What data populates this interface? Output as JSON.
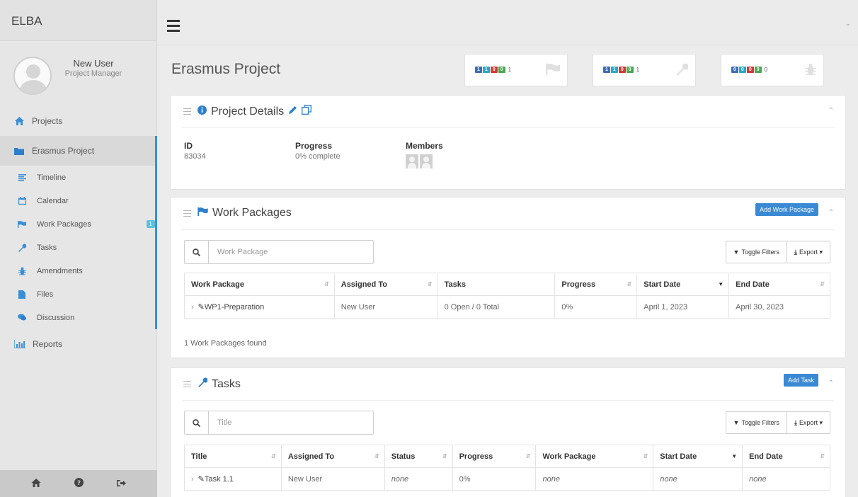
{
  "app": {
    "brand": "ELBA"
  },
  "user": {
    "name": "New User",
    "role": "Project Manager"
  },
  "sidebar": {
    "projects": "Projects",
    "project": "Erasmus Project",
    "subitems": [
      {
        "label": "Timeline",
        "icon": "list-icon"
      },
      {
        "label": "Calendar",
        "icon": "calendar-icon"
      },
      {
        "label": "Work Packages",
        "icon": "flag-icon",
        "badge": "1"
      },
      {
        "label": "Tasks",
        "icon": "wrench-icon"
      },
      {
        "label": "Amendments",
        "icon": "bug-icon"
      },
      {
        "label": "Files",
        "icon": "file-icon"
      },
      {
        "label": "Discussion",
        "icon": "comments-icon"
      }
    ],
    "reports": "Reports"
  },
  "page": {
    "title": "Erasmus Project"
  },
  "stats": [
    {
      "pills": [
        "1",
        "1",
        "0",
        "0"
      ],
      "count": "1",
      "icon": "flag-icon"
    },
    {
      "pills": [
        "1",
        "1",
        "0",
        "0"
      ],
      "count": "1",
      "icon": "wrench-icon"
    },
    {
      "pills": [
        "0",
        "0",
        "0",
        "0"
      ],
      "count": "0",
      "icon": "bug-icon"
    }
  ],
  "details": {
    "title": "Project Details",
    "id_label": "ID",
    "id_value": "83034",
    "progress_label": "Progress",
    "progress_value": "0% complete",
    "members_label": "Members"
  },
  "work_packages": {
    "title": "Work Packages",
    "add_button": "Add Work Package",
    "search_placeholder": "Work Package",
    "toggle_filters": "Toggle Filters",
    "export": "Export",
    "columns": [
      "Work Package",
      "Assigned To",
      "Tasks",
      "Progress",
      "Start Date",
      "End Date"
    ],
    "rows": [
      {
        "name": "WP1-Preparation",
        "assigned": "New User",
        "tasks": "0 Open / 0 Total",
        "progress": "0%",
        "start": "April 1, 2023",
        "end": "April 30, 2023"
      }
    ],
    "found": "1 Work Packages found"
  },
  "tasks": {
    "title": "Tasks",
    "add_button": "Add Task",
    "search_placeholder": "Title",
    "toggle_filters": "Toggle Filters",
    "export": "Export",
    "columns": [
      "Title",
      "Assigned To",
      "Status",
      "Progress",
      "Work Package",
      "Start Date",
      "End Date"
    ],
    "rows": [
      {
        "title": "Task 1.1",
        "assigned": "New User",
        "status": "none",
        "progress": "0%",
        "work_package": "none",
        "start": "none",
        "end": "none"
      }
    ]
  },
  "colors": {
    "accent": "#3a89d4",
    "sidebar_bg": "#e6e6e6",
    "active_bar": "#3a8fd6"
  }
}
